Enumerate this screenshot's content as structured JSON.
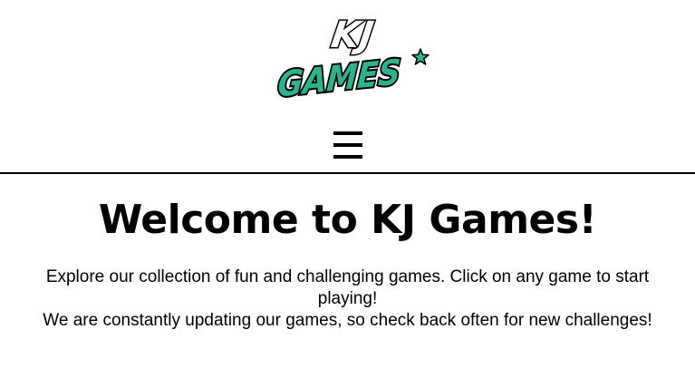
{
  "header": {
    "logo": {
      "line1": "KJ",
      "line2": "GAMES",
      "star_icon": "star-icon",
      "colors": {
        "accent": "#2bb38d",
        "outline": "#000000",
        "fill_top": "#ffffff"
      }
    },
    "menu": {
      "icon": "hamburger-menu-icon",
      "glyph": "☰"
    }
  },
  "main": {
    "title": "Welcome to KJ Games!",
    "paragraph_line1": "Explore our collection of fun and challenging games. Click on any game to start playing!",
    "paragraph_line2": "We are constantly updating our games, so check back often for new challenges!"
  }
}
